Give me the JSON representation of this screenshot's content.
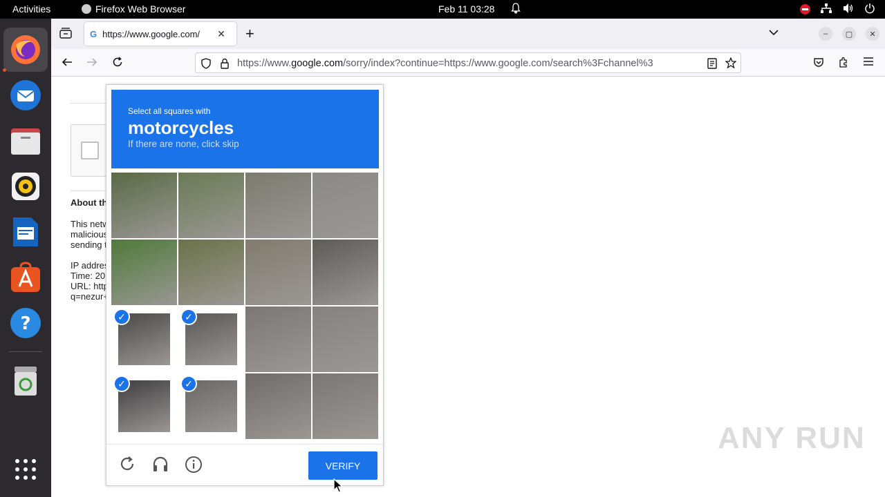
{
  "topbar": {
    "activities": "Activities",
    "app_name": "Firefox Web Browser",
    "clock": "Feb 11  03:28"
  },
  "dock": {
    "items": [
      {
        "name": "firefox-icon",
        "color": "#e66000"
      },
      {
        "name": "thunderbird-icon",
        "color": "#1f74d6"
      },
      {
        "name": "files-icon",
        "color": "#a33"
      },
      {
        "name": "rhythmbox-icon",
        "color": "#f5c211"
      },
      {
        "name": "writer-icon",
        "color": "#1565c0"
      },
      {
        "name": "app-center-icon",
        "color": "#e95420"
      },
      {
        "name": "help-icon",
        "color": "#2a8ae2"
      },
      {
        "name": "trash-icon",
        "color": "#888"
      }
    ]
  },
  "browser": {
    "tab_title": "https://www.google.com/",
    "url_prefix": "https://www.",
    "url_domain": "google.com",
    "url_rest": "/sorry/index?continue=https://www.google.com/search%3Fchannel%3"
  },
  "background_page": {
    "heading": "About th",
    "lines": [
      "This netw",
      "malicious",
      "sending t"
    ],
    "ip_lines": [
      "IP addres",
      "Time: 20",
      "URL: http",
      "q=nezur+"
    ]
  },
  "captcha": {
    "instruction": "Select all squares with",
    "target": "motorcycles",
    "hint": "If there are none, click skip",
    "verify_label": "VERIFY",
    "tiles": [
      {
        "selected": false,
        "color": "#5a6a45"
      },
      {
        "selected": false,
        "color": "#6b7a55"
      },
      {
        "selected": false,
        "color": "#7d7a70"
      },
      {
        "selected": false,
        "color": "#8a8a86"
      },
      {
        "selected": false,
        "color": "#4f7a3a"
      },
      {
        "selected": false,
        "color": "#6a7248"
      },
      {
        "selected": false,
        "color": "#827b6e"
      },
      {
        "selected": false,
        "color": "#5e5b58"
      },
      {
        "selected": true,
        "color": "#4b4a49"
      },
      {
        "selected": true,
        "color": "#5a5856"
      },
      {
        "selected": false,
        "color": "#7b7775"
      },
      {
        "selected": false,
        "color": "#85827f"
      },
      {
        "selected": true,
        "color": "#3f3e40"
      },
      {
        "selected": true,
        "color": "#6a6866"
      },
      {
        "selected": false,
        "color": "#6f6c6a"
      },
      {
        "selected": false,
        "color": "#7a7775"
      }
    ]
  },
  "watermark": "ANY RUN"
}
